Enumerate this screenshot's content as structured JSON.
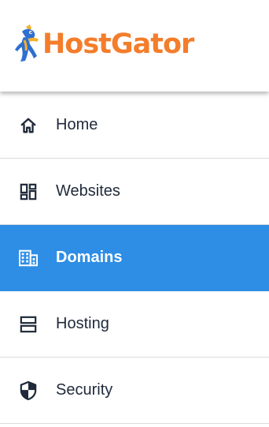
{
  "brand": {
    "name": "HostGator",
    "logo_icon": "gator-mascot-icon",
    "color": "#f47d2b"
  },
  "sidebar": {
    "active_color": "#2e8ee5",
    "items": [
      {
        "label": "Home",
        "icon": "home-icon",
        "active": false
      },
      {
        "label": "Websites",
        "icon": "websites-grid-icon",
        "active": false
      },
      {
        "label": "Domains",
        "icon": "domains-building-icon",
        "active": true
      },
      {
        "label": "Hosting",
        "icon": "hosting-server-icon",
        "active": false
      },
      {
        "label": "Security",
        "icon": "shield-icon",
        "active": false
      }
    ]
  }
}
